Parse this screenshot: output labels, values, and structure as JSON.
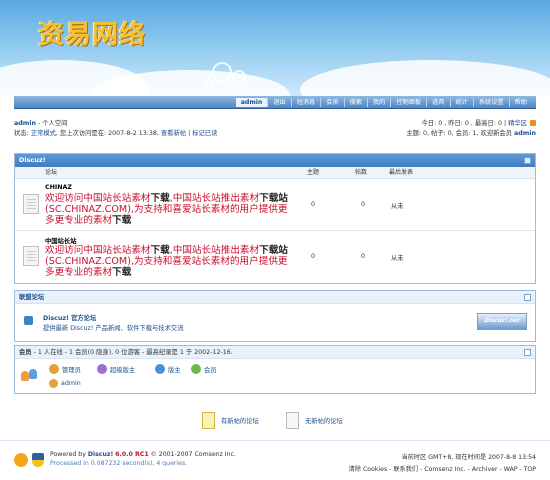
{
  "header": {
    "logo": "资易网络"
  },
  "nav": {
    "items": [
      "admin",
      "退出",
      "短消息",
      "会员",
      "搜索",
      "我的",
      "控制面板",
      "道具",
      "统计",
      "系统设置",
      "帮助"
    ]
  },
  "info": {
    "user": "admin",
    "space": "- 个人空间",
    "status_label": "状态:",
    "status_mode": "正常模式",
    "last_visit": ", 您上次访问是在: 2007-8-2 13:38,",
    "view_new": "查看新帖",
    "mark_read": "标记已读",
    "today_line": "今日: 0 , 昨日: 0 , 最高日: 0 |",
    "digest": "精华区",
    "topics_line": "主题: 0, 帖子: 0, 会员: 1, 欢迎新会员",
    "new_member": "admin"
  },
  "forum_box": {
    "title": "Discuz!",
    "columns": {
      "forum": "论坛",
      "topics": "主题",
      "posts": "帖数",
      "last": "最后发表"
    },
    "forums": [
      {
        "name": "CHINAZ",
        "desc_parts": [
          "欢迎访问中国站长站素材",
          "下载",
          ",中国站长站推出素材",
          "下载站",
          "(SC.CHINAZ.COM),为支持和喜爱站长素材的用户提供更多更专业的素材",
          "下载"
        ],
        "topics": "0",
        "posts": "0",
        "last": "从未"
      },
      {
        "name": "中国站长站",
        "desc_parts": [
          "欢迎访问中国站长站素材",
          "下载",
          ",中国站长站推出素材",
          "下载站",
          "(SC.CHINAZ.COM),为支持和喜爱站长素材的用户提供更多更专业的素材",
          "下载"
        ],
        "topics": "0",
        "posts": "0",
        "last": "从未"
      }
    ]
  },
  "links_box": {
    "title": "联盟论坛",
    "link_title": "Discuz! 官方论坛",
    "link_desc": "提供最新 Discuz! 产品新闻、软件下载与技术交流",
    "banner": "Discuz!.net"
  },
  "members": {
    "label": "会员",
    "summary": "- 1 人在线 - 1 会员(0 隐身), 0 位游客 - 最高纪录是 1 于 2002-12-16.",
    "legend": [
      {
        "label": "管理员",
        "color": "#e2a13a"
      },
      {
        "label": "超级版主",
        "color": "#9b6fd1"
      },
      {
        "label": "版主",
        "color": "#4d8fd6"
      },
      {
        "label": "会员",
        "color": "#6cb94a"
      }
    ],
    "online_user": "admin"
  },
  "bottom_legend": {
    "new": "有新帖的论坛",
    "none": "无新帖的论坛"
  },
  "footer": {
    "powered": "Powered by",
    "product": "Discuz!",
    "version": "6.0.0 RC1",
    "copyright": "© 2001-2007 Comsenz Inc.",
    "processed": "Processed in 0.087232 second(s), 4 queries.",
    "timezone": "当前时区  GMT+8, 现在时间是  2007-8-8 13:54",
    "links": "清除 Cookies - 联系我们 - Comsenz Inc. - Archiver - WAP - TOP"
  },
  "colors": {
    "accent": "#3f7cc0",
    "link": "#1b4d8f",
    "desc_red": "#c8102e"
  }
}
